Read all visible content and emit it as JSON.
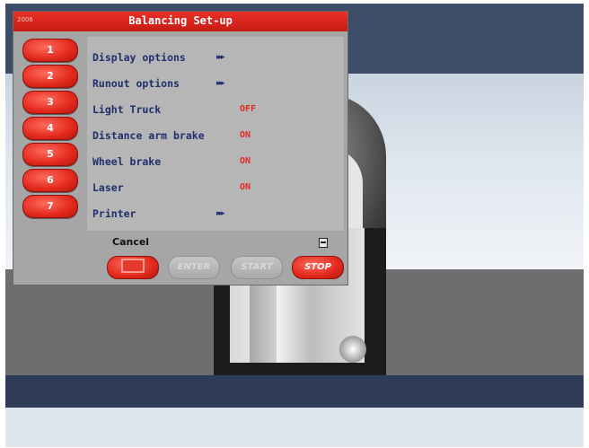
{
  "dialog": {
    "title_code": "2006",
    "title": "Balancing Set-up",
    "items": [
      {
        "number": "1",
        "label": "Display options",
        "value": "",
        "has_submenu": true
      },
      {
        "number": "2",
        "label": "Runout options",
        "value": "",
        "has_submenu": true
      },
      {
        "number": "3",
        "label": "Light Truck",
        "value": "OFF",
        "has_submenu": false
      },
      {
        "number": "4",
        "label": "Distance arm brake",
        "value": "ON",
        "has_submenu": false
      },
      {
        "number": "5",
        "label": "Wheel brake",
        "value": "ON",
        "has_submenu": false
      },
      {
        "number": "6",
        "label": "Laser",
        "value": "ON",
        "has_submenu": false
      },
      {
        "number": "7",
        "label": "Printer",
        "value": "",
        "has_submenu": true
      }
    ],
    "submenu_arrows": "▸▸▸",
    "cancel_label": "Cancel",
    "buttons": {
      "enter": "ENTER",
      "start": "START",
      "stop": "STOP"
    }
  },
  "colors": {
    "accent_red": "#e2281c",
    "label_blue": "#1f2f6c",
    "value_red": "#e42a20",
    "panel_gray": "#b6b6b6"
  },
  "icons": {
    "printer": "printer-icon",
    "cancel": "cancel-icon"
  }
}
